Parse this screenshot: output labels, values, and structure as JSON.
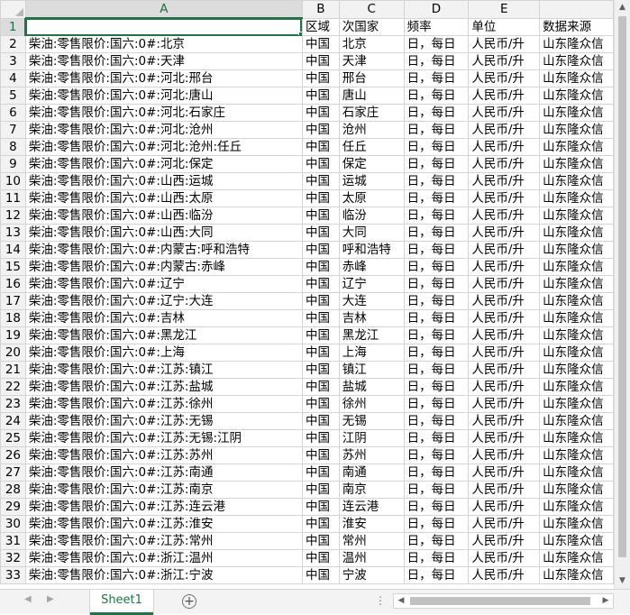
{
  "columns": [
    "A",
    "B",
    "C",
    "D",
    "E",
    ""
  ],
  "header_row": [
    "",
    "区域",
    "次国家",
    "频率",
    "单位",
    "数据来源"
  ],
  "rows": [
    [
      "2",
      "柴油:零售限价:国六:0#:北京",
      "中国",
      "北京",
      "日，每日",
      "人民币/升",
      "山东隆众信"
    ],
    [
      "3",
      "柴油:零售限价:国六:0#:天津",
      "中国",
      "天津",
      "日，每日",
      "人民币/升",
      "山东隆众信"
    ],
    [
      "4",
      "柴油:零售限价:国六:0#:河北:邢台",
      "中国",
      "邢台",
      "日，每日",
      "人民币/升",
      "山东隆众信"
    ],
    [
      "5",
      "柴油:零售限价:国六:0#:河北:唐山",
      "中国",
      "唐山",
      "日，每日",
      "人民币/升",
      "山东隆众信"
    ],
    [
      "6",
      "柴油:零售限价:国六:0#:河北:石家庄",
      "中国",
      "石家庄",
      "日，每日",
      "人民币/升",
      "山东隆众信"
    ],
    [
      "7",
      "柴油:零售限价:国六:0#:河北:沧州",
      "中国",
      "沧州",
      "日，每日",
      "人民币/升",
      "山东隆众信"
    ],
    [
      "8",
      "柴油:零售限价:国六:0#:河北:沧州:任丘",
      "中国",
      "任丘",
      "日，每日",
      "人民币/升",
      "山东隆众信"
    ],
    [
      "9",
      "柴油:零售限价:国六:0#:河北:保定",
      "中国",
      "保定",
      "日，每日",
      "人民币/升",
      "山东隆众信"
    ],
    [
      "10",
      "柴油:零售限价:国六:0#:山西:运城",
      "中国",
      "运城",
      "日，每日",
      "人民币/升",
      "山东隆众信"
    ],
    [
      "11",
      "柴油:零售限价:国六:0#:山西:太原",
      "中国",
      "太原",
      "日，每日",
      "人民币/升",
      "山东隆众信"
    ],
    [
      "12",
      "柴油:零售限价:国六:0#:山西:临汾",
      "中国",
      "临汾",
      "日，每日",
      "人民币/升",
      "山东隆众信"
    ],
    [
      "13",
      "柴油:零售限价:国六:0#:山西:大同",
      "中国",
      "大同",
      "日，每日",
      "人民币/升",
      "山东隆众信"
    ],
    [
      "14",
      "柴油:零售限价:国六:0#:内蒙古:呼和浩特",
      "中国",
      "呼和浩特",
      "日，每日",
      "人民币/升",
      "山东隆众信"
    ],
    [
      "15",
      "柴油:零售限价:国六:0#:内蒙古:赤峰",
      "中国",
      "赤峰",
      "日，每日",
      "人民币/升",
      "山东隆众信"
    ],
    [
      "16",
      "柴油:零售限价:国六:0#:辽宁",
      "中国",
      "辽宁",
      "日，每日",
      "人民币/升",
      "山东隆众信"
    ],
    [
      "17",
      "柴油:零售限价:国六:0#:辽宁:大连",
      "中国",
      "大连",
      "日，每日",
      "人民币/升",
      "山东隆众信"
    ],
    [
      "18",
      "柴油:零售限价:国六:0#:吉林",
      "中国",
      "吉林",
      "日，每日",
      "人民币/升",
      "山东隆众信"
    ],
    [
      "19",
      "柴油:零售限价:国六:0#:黑龙江",
      "中国",
      "黑龙江",
      "日，每日",
      "人民币/升",
      "山东隆众信"
    ],
    [
      "20",
      "柴油:零售限价:国六:0#:上海",
      "中国",
      "上海",
      "日，每日",
      "人民币/升",
      "山东隆众信"
    ],
    [
      "21",
      "柴油:零售限价:国六:0#:江苏:镇江",
      "中国",
      "镇江",
      "日，每日",
      "人民币/升",
      "山东隆众信"
    ],
    [
      "22",
      "柴油:零售限价:国六:0#:江苏:盐城",
      "中国",
      "盐城",
      "日，每日",
      "人民币/升",
      "山东隆众信"
    ],
    [
      "23",
      "柴油:零售限价:国六:0#:江苏:徐州",
      "中国",
      "徐州",
      "日，每日",
      "人民币/升",
      "山东隆众信"
    ],
    [
      "24",
      "柴油:零售限价:国六:0#:江苏:无锡",
      "中国",
      "无锡",
      "日，每日",
      "人民币/升",
      "山东隆众信"
    ],
    [
      "25",
      "柴油:零售限价:国六:0#:江苏:无锡:江阴",
      "中国",
      "江阴",
      "日，每日",
      "人民币/升",
      "山东隆众信"
    ],
    [
      "26",
      "柴油:零售限价:国六:0#:江苏:苏州",
      "中国",
      "苏州",
      "日，每日",
      "人民币/升",
      "山东隆众信"
    ],
    [
      "27",
      "柴油:零售限价:国六:0#:江苏:南通",
      "中国",
      "南通",
      "日，每日",
      "人民币/升",
      "山东隆众信"
    ],
    [
      "28",
      "柴油:零售限价:国六:0#:江苏:南京",
      "中国",
      "南京",
      "日，每日",
      "人民币/升",
      "山东隆众信"
    ],
    [
      "29",
      "柴油:零售限价:国六:0#:江苏:连云港",
      "中国",
      "连云港",
      "日，每日",
      "人民币/升",
      "山东隆众信"
    ],
    [
      "30",
      "柴油:零售限价:国六:0#:江苏:淮安",
      "中国",
      "淮安",
      "日，每日",
      "人民币/升",
      "山东隆众信"
    ],
    [
      "31",
      "柴油:零售限价:国六:0#:江苏:常州",
      "中国",
      "常州",
      "日，每日",
      "人民币/升",
      "山东隆众信"
    ],
    [
      "32",
      "柴油:零售限价:国六:0#:浙江:温州",
      "中国",
      "温州",
      "日，每日",
      "人民币/升",
      "山东隆众信"
    ],
    [
      "33",
      "柴油:零售限价:国六:0#:浙江:宁波",
      "中国",
      "宁波",
      "日，每日",
      "人民币/升",
      "山东隆众信"
    ]
  ],
  "sheet_tab": "Sheet1",
  "colors": {
    "accent": "#217346",
    "header_bg": "#f2f2f2",
    "gridline": "#d4d4d4"
  },
  "icons": {
    "add_sheet": "plus-circle-icon",
    "prev_sheet": "triangle-left-icon",
    "next_sheet": "triangle-right-icon"
  }
}
